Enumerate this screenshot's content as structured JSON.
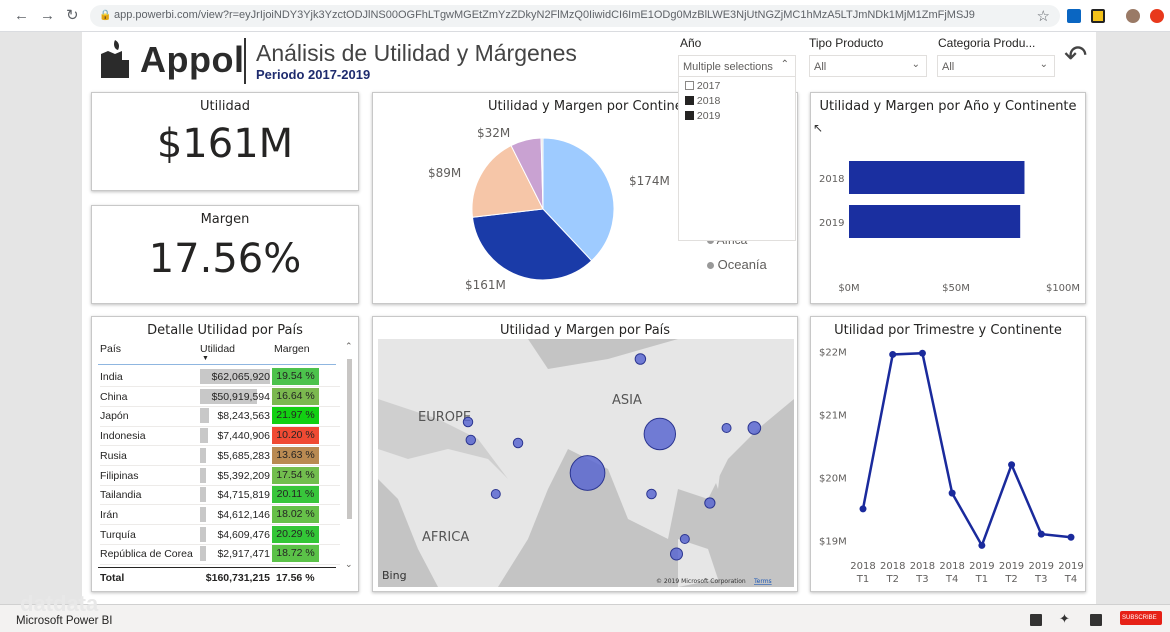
{
  "browser": {
    "back": "←",
    "forward": "→",
    "reload": "↻",
    "url": "app.powerbi.com/view?r=eyJrIjoiNDY3Yjk3YzctODJlNS00OGFhLTgwMGEtZmYzZDkyN2FlMzQ0IiwidCI6ImE1ODg0MzBlLWE3NjUtNGZjMC1hMzA5LTJmNDk1MjM1ZmFjMSJ9",
    "star": "☆"
  },
  "header": {
    "brand": "Appol",
    "title": "Análisis de Utilidad y Márgenes",
    "period": "Periodo 2017-2019"
  },
  "filters": {
    "year": {
      "label": "Año",
      "value": "Multiple selections",
      "options": [
        {
          "label": "2017",
          "checked": false
        },
        {
          "label": "2018",
          "checked": true
        },
        {
          "label": "2019",
          "checked": true
        }
      ]
    },
    "tipo": {
      "label": "Tipo Producto",
      "value": "All"
    },
    "categoria": {
      "label": "Categoria Produ...",
      "value": "All"
    }
  },
  "kpis": {
    "utilidad": {
      "label": "Utilidad",
      "value": "$161M"
    },
    "margen": {
      "label": "Margen",
      "value": "17.56%"
    }
  },
  "pie": {
    "title": "Utilidad y Margen por Continente",
    "legend_visible": [
      "Africa",
      "Oceanía"
    ],
    "colors": [
      "#9ecbff",
      "#1a3ba8",
      "#f6c6a8",
      "#c9a2d2",
      "#e0e0e0"
    ],
    "labels": [
      "$174M",
      "$161M",
      "$89M",
      "$32M"
    ]
  },
  "bar_year": {
    "title": "Utilidad y Margen por Año y Continente",
    "color": "#1a2fa0"
  },
  "table": {
    "title": "Detalle Utilidad por País",
    "headers": {
      "pais": "País",
      "utilidad": "Utilidad",
      "margen": "Margen"
    },
    "rows": [
      {
        "pais": "India",
        "utilidad": "$62,065,920",
        "margen": "19.54 %",
        "color": "#4cc24c"
      },
      {
        "pais": "China",
        "utilidad": "$50,919,594",
        "margen": "16.64 %",
        "color": "#7bb84f"
      },
      {
        "pais": "Japón",
        "utilidad": "$8,243,563",
        "margen": "21.97 %",
        "color": "#12d012"
      },
      {
        "pais": "Indonesia",
        "utilidad": "$7,440,906",
        "margen": "10.20 %",
        "color": "#f04a33"
      },
      {
        "pais": "Rusia",
        "utilidad": "$5,685,283",
        "margen": "13.63 %",
        "color": "#b98a52"
      },
      {
        "pais": "Filipinas",
        "utilidad": "$5,392,209",
        "margen": "17.54 %",
        "color": "#72be4e"
      },
      {
        "pais": "Tailandia",
        "utilidad": "$4,715,819",
        "margen": "20.11 %",
        "color": "#38c63b"
      },
      {
        "pais": "Irán",
        "utilidad": "$4,612,146",
        "margen": "18.02 %",
        "color": "#66c049"
      },
      {
        "pais": "Turquía",
        "utilidad": "$4,609,476",
        "margen": "20.29 %",
        "color": "#33c637"
      },
      {
        "pais": "República de Corea",
        "utilidad": "$2,917,471",
        "margen": "18.72 %",
        "color": "#5bc248"
      }
    ],
    "total": {
      "label": "Total",
      "utilidad": "$160,731,215",
      "margen": "17.56 %"
    }
  },
  "map": {
    "title": "Utilidad y Margen por País",
    "regions": [
      "EUROPE",
      "ASIA",
      "AFRICA"
    ],
    "bing": "Bing",
    "copyright": "© 2019 Microsoft Corporation",
    "terms": "Terms",
    "bubble_color": "#5b67d0"
  },
  "line": {
    "title": "Utilidad por Trimestre y Continente",
    "color": "#1a2a9c"
  },
  "taskbar": {
    "app": "Microsoft Power BI",
    "watermark": "datdata",
    "subscribe": "SUBSCRIBE"
  },
  "chart_data": [
    {
      "type": "pie",
      "title": "Utilidad y Margen por Continente",
      "slices": [
        {
          "label": "$174M",
          "value": 174
        },
        {
          "label": "$161M",
          "value": 161
        },
        {
          "label": "$89M",
          "value": 89
        },
        {
          "label": "$32M",
          "value": 32
        },
        {
          "label": "",
          "value": 2
        }
      ]
    },
    {
      "type": "bar",
      "orientation": "horizontal",
      "title": "Utilidad y Margen por Año y Continente",
      "categories": [
        "2018",
        "2019"
      ],
      "values": [
        82,
        80
      ],
      "xlim": [
        0,
        100
      ],
      "xticks": [
        "$0M",
        "$50M",
        "$100M"
      ]
    },
    {
      "type": "line",
      "title": "Utilidad por Trimestre y Continente",
      "x": [
        [
          "2018",
          "T1"
        ],
        [
          "2018",
          "T2"
        ],
        [
          "2018",
          "T3"
        ],
        [
          "2018",
          "T4"
        ],
        [
          "2019",
          "T1"
        ],
        [
          "2019",
          "T2"
        ],
        [
          "2019",
          "T3"
        ],
        [
          "2019",
          "T4"
        ]
      ],
      "values": [
        19.5,
        21.95,
        21.97,
        19.75,
        18.92,
        20.2,
        19.1,
        19.05
      ],
      "ylim": [
        18.8,
        22.1
      ],
      "yticks": [
        19,
        20,
        21,
        22
      ],
      "ytick_labels": [
        "$19M",
        "$20M",
        "$21M",
        "$22M"
      ]
    },
    {
      "type": "scatter",
      "title": "Utilidad y Margen por País",
      "points": [
        {
          "lon": 78,
          "lat": 22,
          "size": 62.07
        },
        {
          "lon": 104,
          "lat": 35,
          "size": 50.92
        },
        {
          "lon": 97,
          "lat": 60,
          "size": 5.69
        },
        {
          "lon": 138,
          "lat": 37,
          "size": 8.24
        },
        {
          "lon": 128,
          "lat": 37,
          "size": 2.92
        },
        {
          "lon": 35,
          "lat": 39,
          "size": 4.61
        },
        {
          "lon": 36,
          "lat": 33,
          "size": 4.61
        },
        {
          "lon": 53,
          "lat": 32,
          "size": 4.61
        },
        {
          "lon": 45,
          "lat": 15,
          "size": 2.5
        },
        {
          "lon": 101,
          "lat": 15,
          "size": 4.72
        },
        {
          "lon": 122,
          "lat": 12,
          "size": 5.39
        },
        {
          "lon": 113,
          "lat": 0,
          "size": 3.5
        },
        {
          "lon": 110,
          "lat": -5,
          "size": 7.44
        }
      ]
    }
  ]
}
